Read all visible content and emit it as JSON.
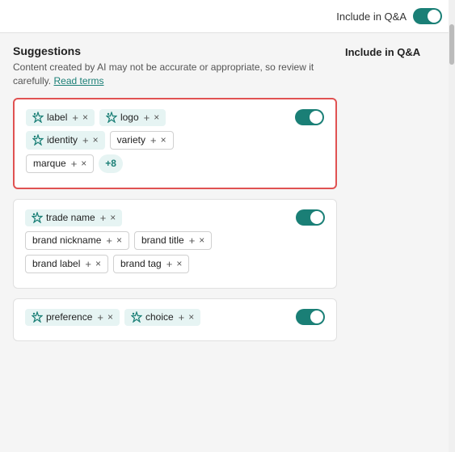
{
  "topbar": {
    "toggle_label": "Include in Q&A",
    "toggle_on": true
  },
  "suggestions": {
    "title": "Suggestions",
    "description": "Content created by AI may not be accurate or appropriate, so review it carefully.",
    "read_terms": "Read terms",
    "right_label": "Include in Q&A"
  },
  "cards": [
    {
      "id": "card1",
      "highlighted": true,
      "toggle_on": true,
      "rows": [
        [
          {
            "icon": true,
            "text": "label",
            "hasPlus": true,
            "hasClose": true,
            "bg": "teal"
          },
          {
            "icon": true,
            "text": "logo",
            "hasPlus": true,
            "hasClose": true,
            "bg": "teal"
          }
        ],
        [
          {
            "icon": true,
            "text": "identity",
            "hasPlus": true,
            "hasClose": true,
            "bg": "teal"
          },
          {
            "icon": false,
            "text": "variety",
            "hasPlus": true,
            "hasClose": true,
            "bg": "white"
          }
        ],
        [
          {
            "icon": false,
            "text": "marque",
            "hasPlus": true,
            "hasClose": true,
            "bg": "white"
          },
          {
            "more": true,
            "text": "+8"
          }
        ]
      ]
    },
    {
      "id": "card2",
      "highlighted": false,
      "toggle_on": true,
      "rows": [
        [
          {
            "icon": true,
            "text": "trade name",
            "hasPlus": true,
            "hasClose": true,
            "bg": "teal"
          }
        ],
        [
          {
            "icon": false,
            "text": "brand nickname",
            "hasPlus": true,
            "hasClose": true,
            "bg": "white"
          },
          {
            "icon": false,
            "text": "brand title",
            "hasPlus": true,
            "hasClose": true,
            "bg": "white"
          }
        ],
        [
          {
            "icon": false,
            "text": "brand label",
            "hasPlus": true,
            "hasClose": true,
            "bg": "white"
          },
          {
            "icon": false,
            "text": "brand tag",
            "hasPlus": true,
            "hasClose": true,
            "bg": "white"
          }
        ]
      ]
    },
    {
      "id": "card3",
      "highlighted": false,
      "toggle_on": true,
      "rows": [
        [
          {
            "icon": true,
            "text": "preference",
            "hasPlus": true,
            "hasClose": true,
            "bg": "teal"
          },
          {
            "icon": true,
            "text": "choice",
            "hasPlus": true,
            "hasClose": true,
            "bg": "teal"
          }
        ]
      ]
    }
  ],
  "icons": {
    "ai": "✦",
    "plus": "+",
    "close": "×"
  }
}
